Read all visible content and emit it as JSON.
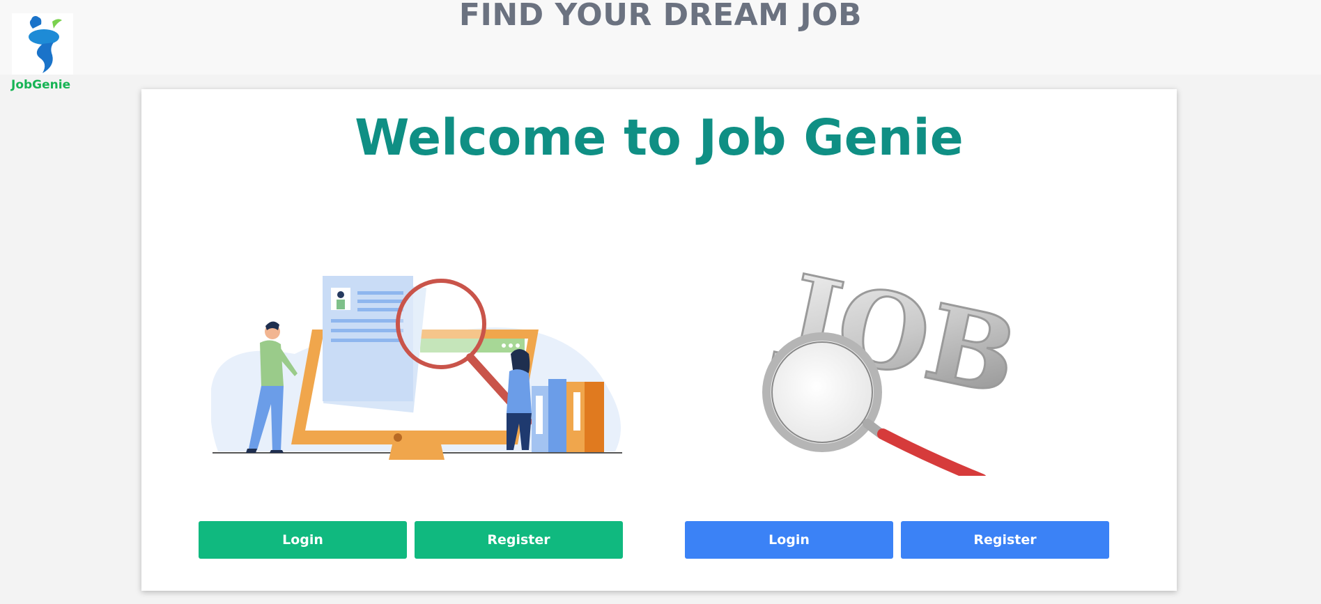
{
  "header": {
    "brand": "JobGenie",
    "headline": "FIND YOUR DREAM JOB"
  },
  "card": {
    "welcome": "Welcome to Job Genie",
    "left_panel": {
      "login_label": "Login",
      "register_label": "Register",
      "accent": "#10b97f"
    },
    "right_panel": {
      "login_label": "Login",
      "register_label": "Register",
      "accent": "#3b82f6",
      "illustration_text": "JOB"
    }
  },
  "colors": {
    "brand_green": "#16b454",
    "welcome_teal": "#0f8f84",
    "headline_gray": "#6b7280"
  },
  "icons": [
    "genie-logo-icon",
    "job-search-illustration",
    "job-magnifier-illustration"
  ]
}
